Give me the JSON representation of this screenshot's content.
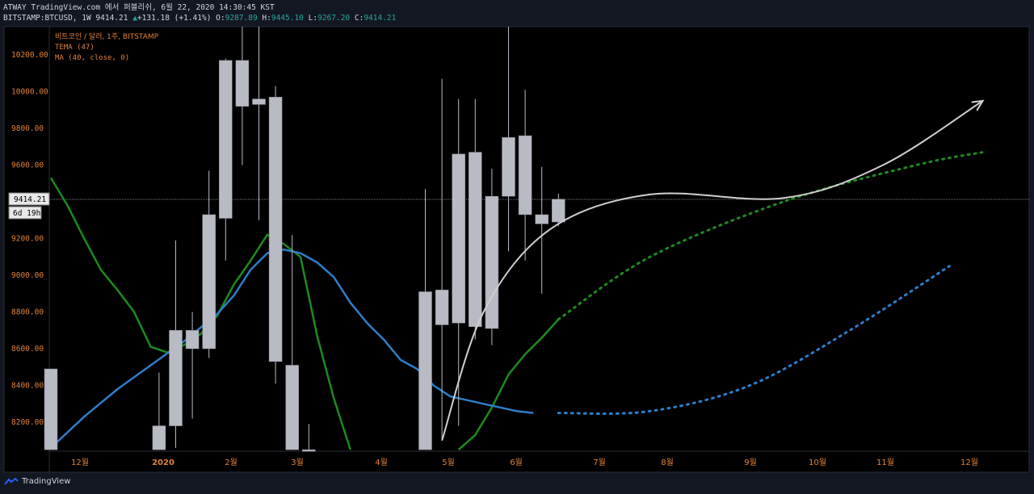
{
  "header": {
    "line1": "ATWAY TradingView.com 에서 퍼블리쉬, 6월 22, 2020 14:30:45 KST",
    "symbol": "BITSTAMP:BTCUSD, 1W",
    "last": "9414.21",
    "change_arrow": "▲",
    "change": "+131.18 (+1.41%)",
    "o_label": "O:",
    "o_value": "9287.89",
    "h_label": "H:",
    "h_value": "9445.10",
    "l_label": "L:",
    "l_value": "9267.20",
    "c_label": "C:",
    "c_value": "9414.21"
  },
  "legend": {
    "title": "비트코인 / 달러, 1주, BITSTAMP",
    "tema": "TEMA (47)",
    "ma": "MA (40, close, 0)"
  },
  "price_label": "9414.21",
  "countdown_label": "6d 19h",
  "brand": "TradingView",
  "colors": {
    "background": "#000000",
    "candle": "#b8bac4",
    "tema": "#1e8a1e",
    "ma": "#2e7dc9",
    "projection": "#d0d0d0",
    "axis_text": "#e0813a",
    "legend_text": "#e0813a"
  },
  "chart_data": {
    "type": "candlestick",
    "y_ticks": [
      "10200.00",
      "10000.00",
      "9800.00",
      "9600.00",
      "9400.00",
      "9200.00",
      "9000.00",
      "8800.00",
      "8600.00",
      "8400.00",
      "8200.00"
    ],
    "x_ticks": [
      "12월",
      "2020",
      "2월",
      "3월",
      "4월",
      "5월",
      "6월",
      "7월",
      "8월",
      "9월",
      "10월",
      "11월",
      "12월"
    ],
    "ylim": [
      8050,
      10300
    ],
    "candles": [
      {
        "x": 0,
        "o": 8490,
        "h": 8490,
        "l": 8050,
        "c": 8050
      },
      {
        "x": 6.5,
        "o": 8180,
        "h": 8470,
        "l": 8050,
        "c": 8050
      },
      {
        "x": 7.5,
        "o": 8180,
        "h": 9190,
        "l": 8060,
        "c": 8700
      },
      {
        "x": 8.5,
        "o": 8600,
        "h": 8800,
        "l": 8220,
        "c": 8700
      },
      {
        "x": 9.5,
        "o": 8600,
        "h": 9570,
        "l": 8550,
        "c": 9330
      },
      {
        "x": 10.5,
        "o": 9310,
        "h": 10180,
        "l": 9080,
        "c": 10170
      },
      {
        "x": 11.5,
        "o": 10170,
        "h": 10480,
        "l": 9600,
        "c": 9920
      },
      {
        "x": 12.5,
        "o": 9960,
        "h": 10420,
        "l": 9300,
        "c": 9930
      },
      {
        "x": 13.5,
        "o": 9970,
        "h": 10030,
        "l": 8410,
        "c": 8530
      },
      {
        "x": 14.5,
        "o": 8510,
        "h": 9220,
        "l": 8050,
        "c": 8050
      },
      {
        "x": 15.5,
        "o": 8050,
        "h": 8190,
        "l": 8050,
        "c": 8050
      },
      {
        "x": 22.5,
        "o": 8050,
        "h": 9470,
        "l": 8050,
        "c": 8910
      },
      {
        "x": 23.5,
        "o": 8730,
        "h": 10070,
        "l": 8100,
        "c": 8920
      },
      {
        "x": 24.5,
        "o": 8740,
        "h": 9960,
        "l": 8180,
        "c": 9660
      },
      {
        "x": 25.5,
        "o": 8720,
        "h": 9960,
        "l": 8650,
        "c": 9670
      },
      {
        "x": 26.5,
        "o": 8710,
        "h": 9580,
        "l": 8620,
        "c": 9430
      },
      {
        "x": 27.5,
        "o": 9430,
        "h": 10390,
        "l": 9130,
        "c": 9750
      },
      {
        "x": 28.5,
        "o": 9330,
        "h": 10010,
        "l": 9080,
        "c": 9760
      },
      {
        "x": 29.5,
        "o": 9280,
        "h": 9590,
        "l": 8900,
        "c": 9330
      },
      {
        "x": 30.5,
        "o": 9290,
        "h": 9445,
        "l": 9267,
        "c": 9414
      }
    ],
    "series": [
      {
        "name": "TEMA (47)",
        "points": [
          [
            0,
            9530
          ],
          [
            1,
            9380
          ],
          [
            2,
            9200
          ],
          [
            3,
            9030
          ],
          [
            4,
            8920
          ],
          [
            5,
            8800
          ],
          [
            6,
            8610
          ],
          [
            7,
            8580
          ],
          [
            8,
            8620
          ],
          [
            9,
            8680
          ],
          [
            10,
            8780
          ],
          [
            11,
            8950
          ],
          [
            12,
            9080
          ],
          [
            13,
            9220
          ],
          [
            14,
            9170
          ],
          [
            15,
            9100
          ],
          [
            16,
            8670
          ],
          [
            17,
            8330
          ],
          [
            18,
            8050
          ]
        ]
      },
      {
        "name": "TEMA (47)",
        "points": [
          [
            24.5,
            8050
          ],
          [
            25.5,
            8130
          ],
          [
            26.5,
            8280
          ],
          [
            27.5,
            8460
          ],
          [
            28.5,
            8570
          ],
          [
            29.5,
            8660
          ],
          [
            30.5,
            8760
          ]
        ]
      },
      {
        "name": "MA (40, close, 0)",
        "points": [
          [
            0,
            8060
          ],
          [
            2,
            8230
          ],
          [
            4,
            8380
          ],
          [
            6,
            8510
          ],
          [
            8,
            8640
          ],
          [
            10,
            8790
          ],
          [
            11,
            8890
          ],
          [
            12,
            9030
          ],
          [
            13,
            9120
          ],
          [
            14,
            9140
          ],
          [
            15,
            9120
          ],
          [
            16,
            9070
          ],
          [
            17,
            8990
          ],
          [
            18,
            8850
          ],
          [
            19,
            8740
          ],
          [
            20,
            8650
          ],
          [
            21,
            8540
          ],
          [
            22,
            8490
          ],
          [
            23,
            8400
          ],
          [
            24,
            8340
          ],
          [
            25,
            8320
          ],
          [
            26,
            8300
          ],
          [
            27,
            8280
          ],
          [
            28,
            8260
          ],
          [
            29,
            8250
          ]
        ]
      }
    ],
    "projections": [
      {
        "style": "dotted",
        "color": "tema",
        "points": [
          [
            30.5,
            8760
          ],
          [
            36,
            9100
          ],
          [
            44,
            9400
          ],
          [
            52,
            9600
          ],
          [
            56,
            9670
          ]
        ]
      },
      {
        "style": "dotted",
        "color": "ma",
        "points": [
          [
            30.5,
            8250
          ],
          [
            36,
            8260
          ],
          [
            42,
            8400
          ],
          [
            48,
            8700
          ],
          [
            54,
            9050
          ]
        ]
      },
      {
        "style": "solid-arrow",
        "color": "projection",
        "points": [
          [
            23.5,
            8100
          ],
          [
            26,
            8800
          ],
          [
            30,
            9250
          ],
          [
            36,
            9440
          ],
          [
            44,
            9420
          ],
          [
            50,
            9600
          ],
          [
            56,
            9950
          ]
        ]
      }
    ]
  }
}
